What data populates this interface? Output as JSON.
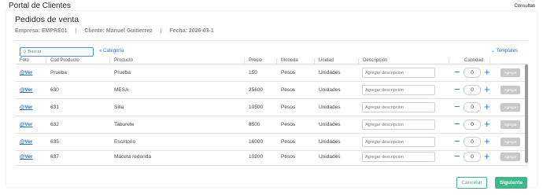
{
  "app": {
    "title": "Portal de Clientes",
    "top_link": "Consultas"
  },
  "page": {
    "title": "Pedidos de venta",
    "empresa": "Empresa: EMPRE01",
    "separator": "|",
    "cliente": "Cliente: Manuel Guitierrez",
    "fecha": "Fecha: 2026-03-1"
  },
  "toolbar": {
    "search_placeholder": "Buscar",
    "categoria_label": "Categoría",
    "templates_label": "Templates"
  },
  "table": {
    "headers": [
      "Foto",
      "Cod Producto",
      "Producto",
      "Precio",
      "Moneda",
      "Unidad",
      "Descripción",
      "Cantidad"
    ],
    "rows": [
      {
        "foto": "@Ver",
        "codigo": "Prueba",
        "producto": "Prueba",
        "precio": "150",
        "moneda": "Pesos",
        "unidad": "Unidades",
        "descripcion_placeholder": "Agregar descripcion",
        "cantidad": "0",
        "agregar": "Agregar"
      },
      {
        "foto": "@Ver",
        "codigo": "630",
        "producto": "MESA",
        "precio": "25600",
        "moneda": "Pesos",
        "unidad": "Unidades",
        "descripcion_placeholder": "Agregar descripcion",
        "cantidad": "0",
        "agregar": "Agregar"
      },
      {
        "foto": "@Ver",
        "codigo": "631",
        "producto": "Silla",
        "precio": "10500",
        "moneda": "Pesos",
        "unidad": "Unidades",
        "descripcion_placeholder": "Agregar descripcion",
        "cantidad": "0",
        "agregar": "Agregar"
      },
      {
        "foto": "@Ver",
        "codigo": "632",
        "producto": "Taburete",
        "precio": "8500",
        "moneda": "Pesos",
        "unidad": "Unidades",
        "descripcion_placeholder": "Agregar descripcion",
        "cantidad": "0",
        "agregar": "Agregar"
      },
      {
        "foto": "@Ver",
        "codigo": "635",
        "producto": "Escritorio",
        "precio": "16000",
        "moneda": "Pesos",
        "unidad": "Unidades",
        "descripcion_placeholder": "Agregar descripcion",
        "cantidad": "0",
        "agregar": "Agregar"
      },
      {
        "foto": "@Ver",
        "codigo": "637",
        "producto": "Maceta redonda",
        "precio": "10200",
        "moneda": "Pesos",
        "unidad": "Unidades",
        "descripcion_placeholder": "Agregar descripcion",
        "cantidad": "0",
        "agregar": "Agregar"
      }
    ]
  },
  "footer": {
    "cancel_label": "Cancelar",
    "next_label": "Siguiente"
  },
  "icons": {
    "search": "search-icon",
    "chevron": "chevron-down-icon",
    "minus": "minus-icon",
    "plus": "plus-icon"
  },
  "colors": {
    "accent_blue": "#2a74c4",
    "primary_green": "#3db88b",
    "disabled_gray": "#c8c8c8"
  }
}
